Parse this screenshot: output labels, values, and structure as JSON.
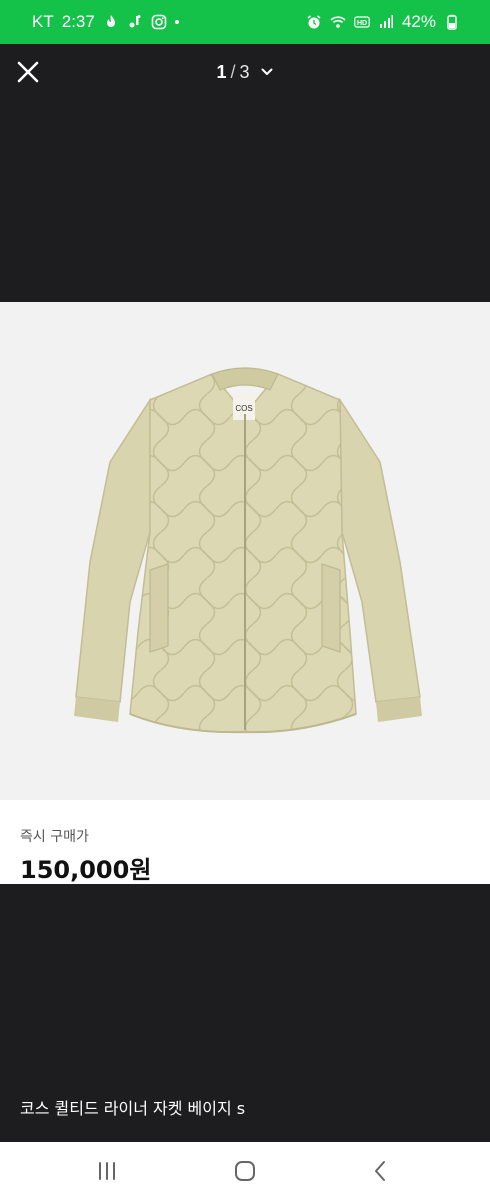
{
  "status_bar": {
    "carrier": "KT",
    "time": "2:37",
    "battery": "42%",
    "left_icons": [
      "fire-icon",
      "notification-icon",
      "instagram-icon"
    ],
    "right_icons": [
      "alarm-icon",
      "wifi-icon",
      "hd-voice-icon",
      "signal-icon",
      "battery-charging-icon"
    ],
    "color": "#14c24a"
  },
  "viewer": {
    "current_page": "1",
    "separator": "/",
    "total_pages": "3"
  },
  "product": {
    "brand_tag": "COS",
    "price_label": "즉시 구매가",
    "price": "150,000원",
    "title": "코스 퀼티드 라이너 자켓 베이지 s"
  },
  "nav": {
    "buttons": [
      "recent-apps-icon",
      "home-icon",
      "back-icon"
    ]
  }
}
